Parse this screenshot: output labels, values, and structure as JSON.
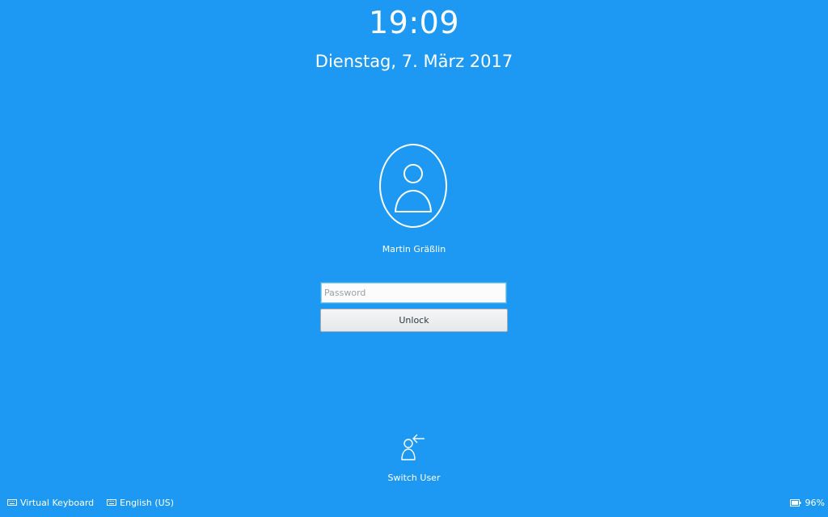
{
  "lockscreen": {
    "time": "19:09",
    "date": "Dienstag, 7. März 2017",
    "user_name": "Martin Gräßlin",
    "password_placeholder": "Password",
    "unlock_label": "Unlock",
    "switch_user_label": "Switch User"
  },
  "footer": {
    "virtual_keyboard_label": "Virtual Keyboard",
    "keyboard_layout_label": "English (US)",
    "battery_percent": "96%"
  },
  "colors": {
    "background": "#1d99f3",
    "text": "#ffffff",
    "focus_border": "#3daee9"
  },
  "icons": {
    "avatar": "user-avatar-icon",
    "switch_user": "switch-user-icon",
    "virtual_keyboard": "keyboard-icon",
    "keyboard_layout": "keyboard-layout-icon",
    "battery": "battery-icon"
  }
}
